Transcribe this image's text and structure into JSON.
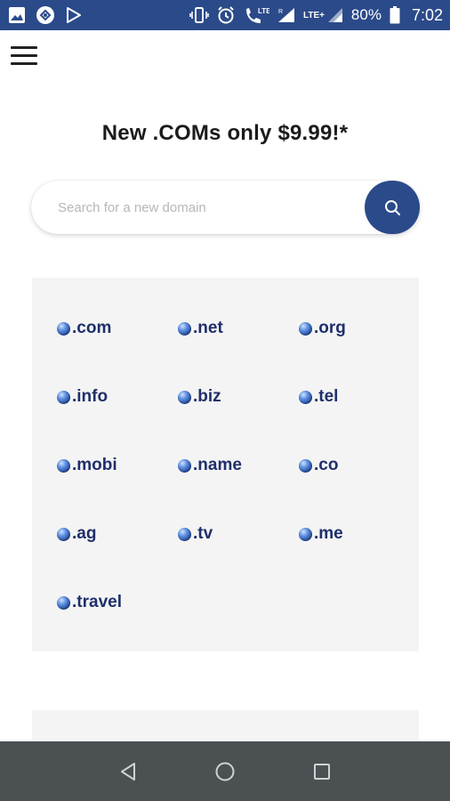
{
  "status_bar": {
    "left_icons": [
      "image-icon",
      "app-icon",
      "play-store-icon"
    ],
    "right_icons": [
      "vibrate-icon",
      "alarm-icon",
      "wifi-calling-icon",
      "signal-icon",
      "lte-signal-icon",
      "battery-icon"
    ],
    "lte_label": "LTE",
    "lte_plus_label": "LTE+",
    "battery": "80%",
    "time": "7:02"
  },
  "header": {
    "menu_icon": "hamburger-menu-icon"
  },
  "promo": {
    "title": "New .COMs only $9.99!*"
  },
  "search": {
    "placeholder": "Search for a new domain",
    "button_icon": "search-icon"
  },
  "tlds": [
    ".com",
    ".net",
    ".org",
    ".info",
    ".biz",
    ".tel",
    ".mobi",
    ".name",
    ".co",
    ".ag",
    ".tv",
    ".me",
    ".travel"
  ],
  "nav_bar": {
    "icons": [
      "back-icon",
      "home-icon",
      "recents-icon"
    ]
  },
  "colors": {
    "primary": "#2b4a8a",
    "tld_text": "#1f2f6b",
    "panel_bg": "#f4f4f4",
    "nav_bg": "#4b5053"
  }
}
